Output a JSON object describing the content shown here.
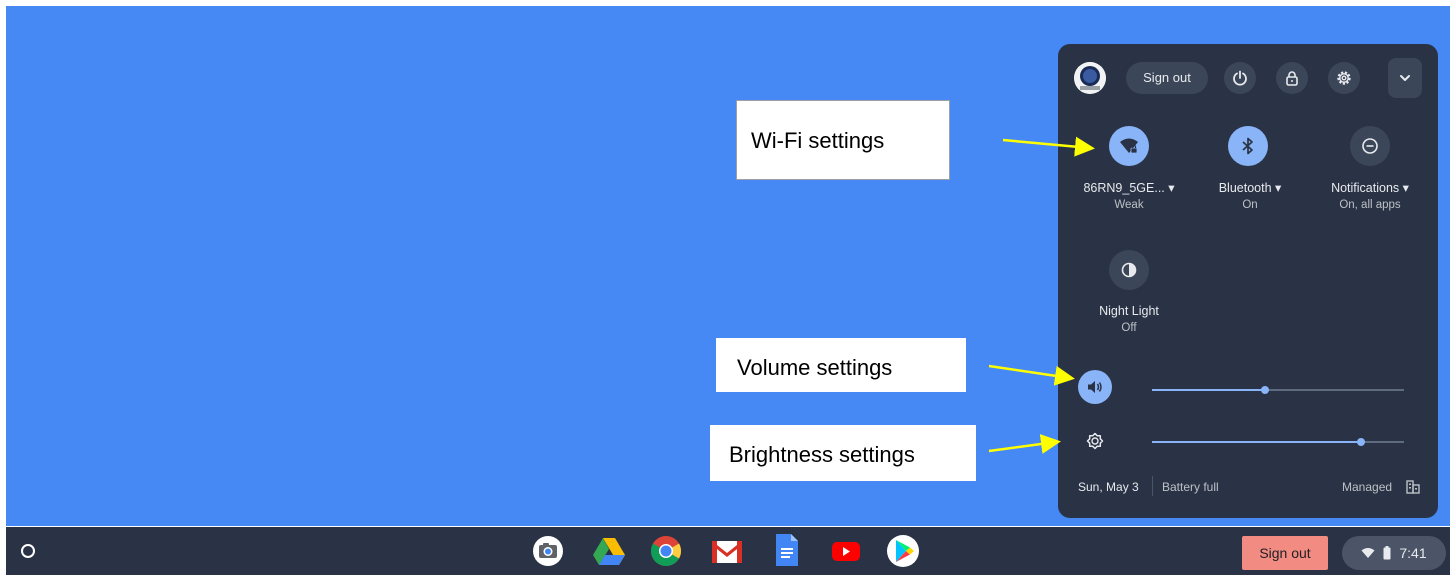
{
  "quick_settings": {
    "sign_out_label": "Sign out",
    "tiles": [
      {
        "label": "86RN9_5GE... ▾",
        "sub": "Weak",
        "icon": "wifi-lock-icon",
        "state": "on"
      },
      {
        "label": "Bluetooth ▾",
        "sub": "On",
        "icon": "bluetooth-icon",
        "state": "on"
      },
      {
        "label": "Notifications ▾",
        "sub": "On, all apps",
        "icon": "do-not-disturb-icon",
        "state": "off"
      },
      {
        "label": "Night Light",
        "sub": "Off",
        "icon": "night-light-icon",
        "state": "off"
      }
    ],
    "volume_level": 0.45,
    "brightness_level": 0.83,
    "date": "Sun, May 3",
    "battery": "Battery full",
    "managed": "Managed"
  },
  "callouts": {
    "wifi": "Wi-Fi settings",
    "volume": "Volume settings",
    "brightness": "Brightness settings"
  },
  "shelf": {
    "apps": [
      "camera-icon",
      "drive-icon",
      "chrome-icon",
      "gmail-icon",
      "docs-icon",
      "youtube-icon",
      "play-store-icon"
    ],
    "sign_out_label": "Sign out",
    "time": "7:41"
  },
  "colors": {
    "desktop": "#4688f4",
    "panel": "#293345",
    "accent": "#8ab4f8",
    "callout_arrow": "#ffff00",
    "shelf_signout": "#f28b82"
  }
}
